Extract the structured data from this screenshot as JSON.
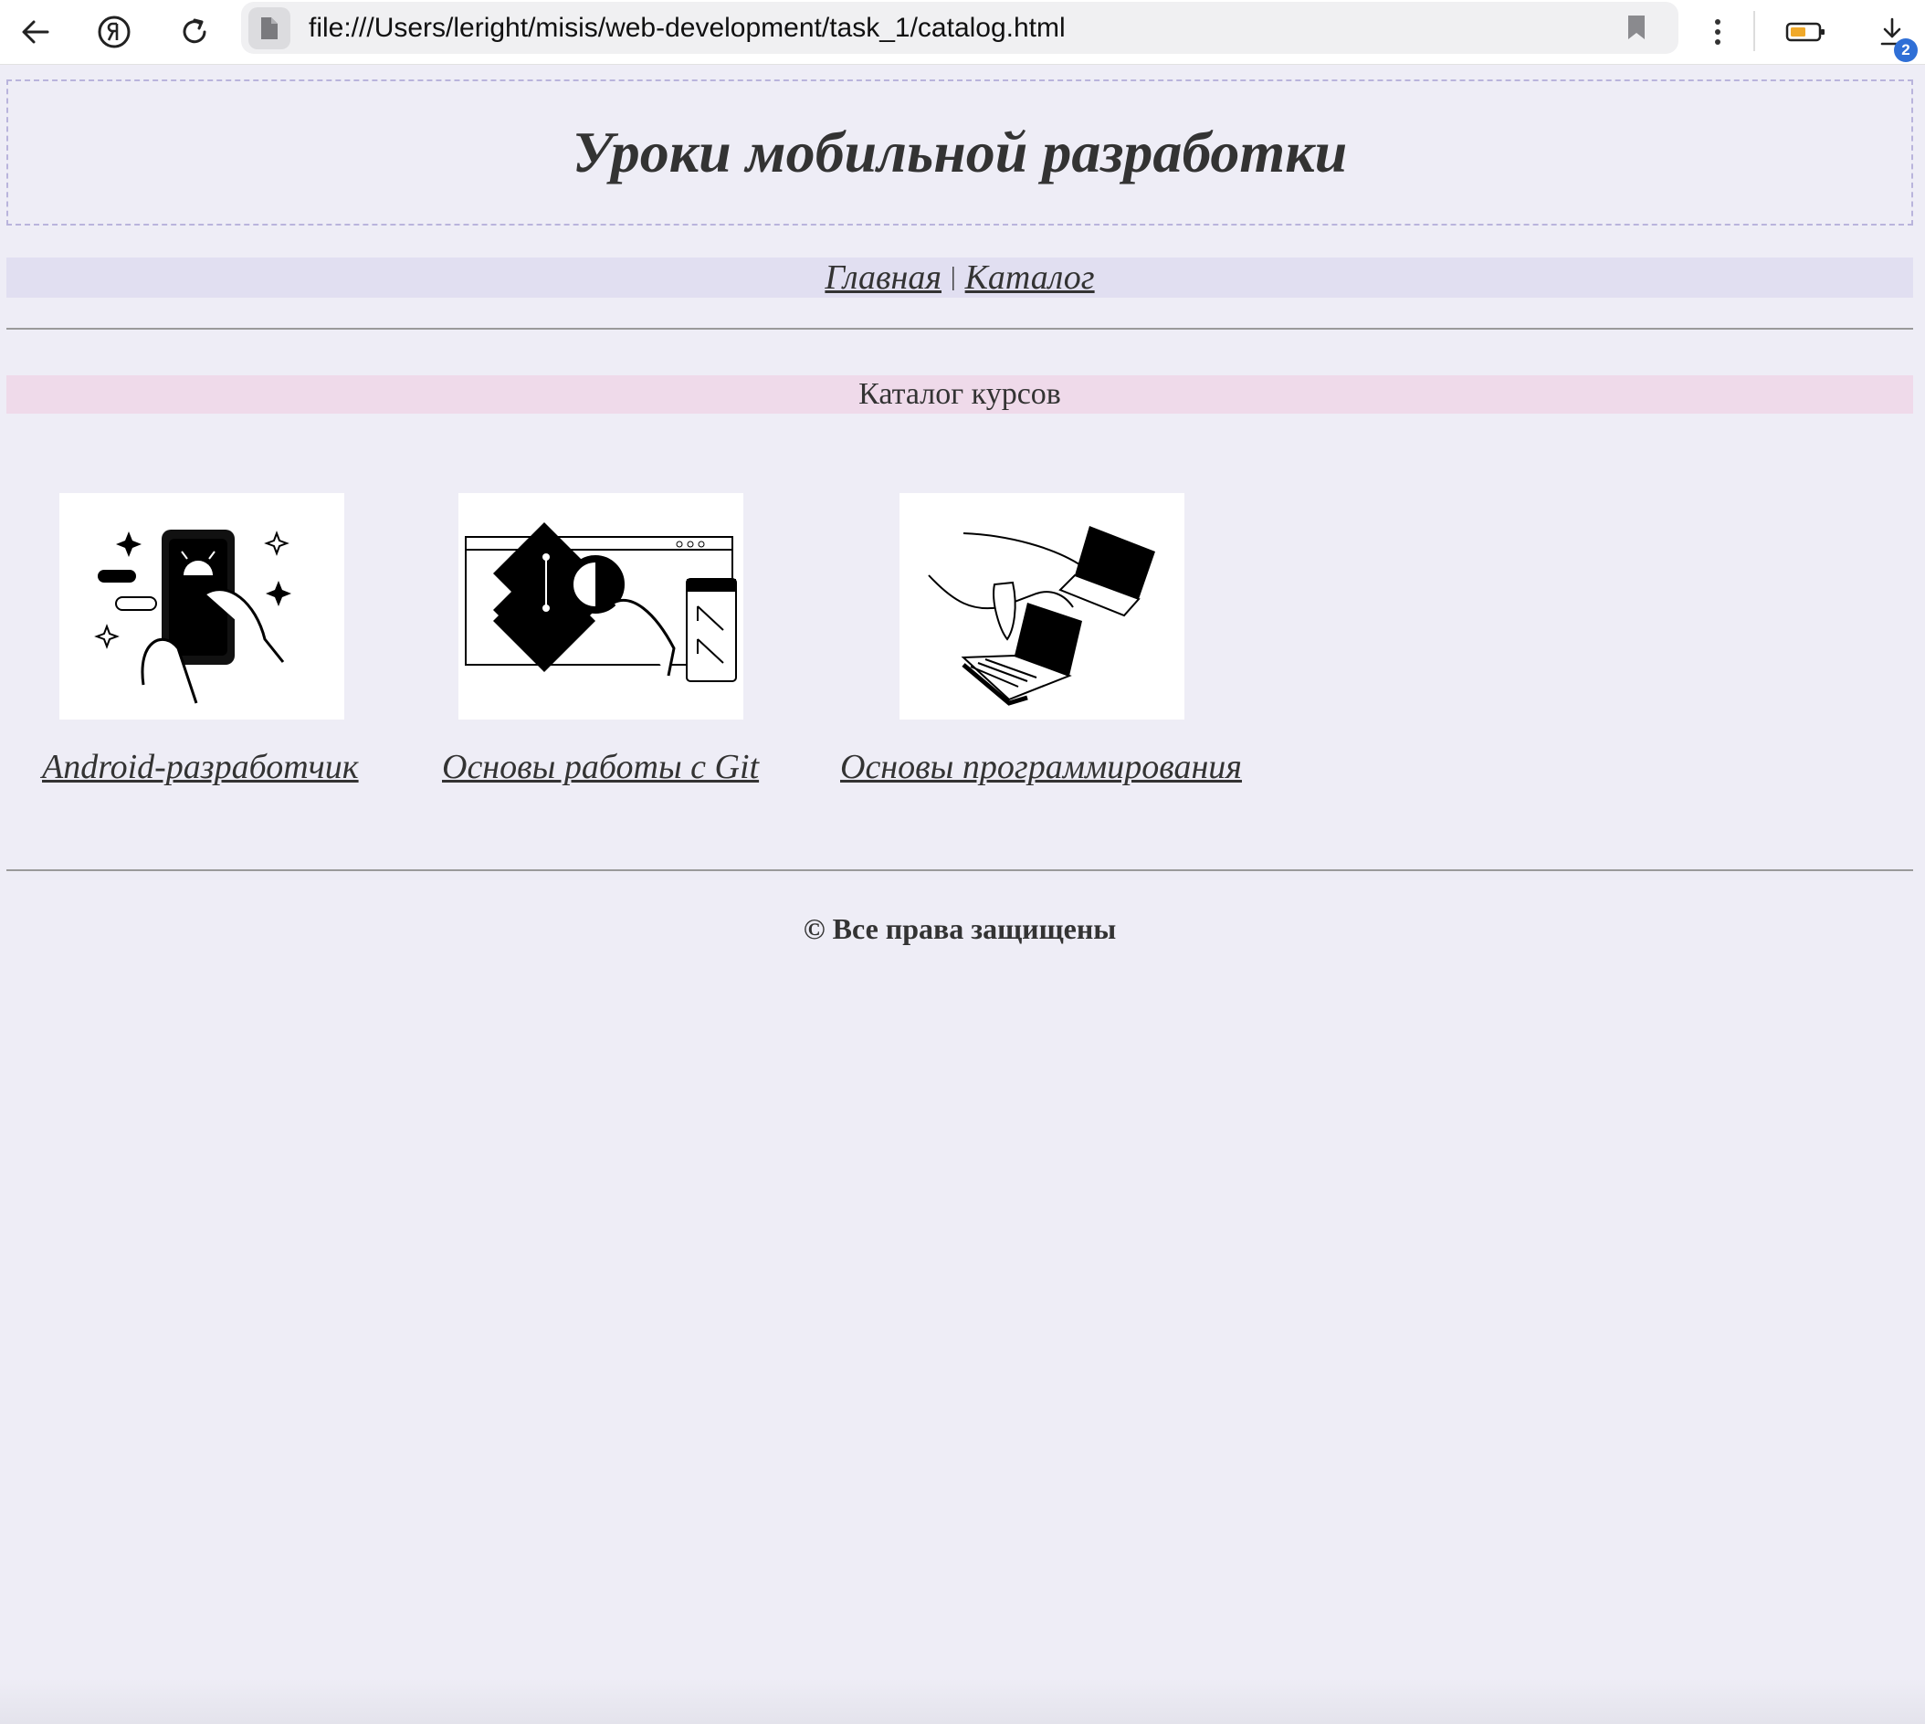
{
  "browser": {
    "url": "file:///Users/leright/misis/web-development/task_1/catalog.html",
    "downloads_count": "2",
    "icons": [
      "back-arrow-icon",
      "yandex-icon",
      "reload-icon",
      "page-icon",
      "bookmark-icon",
      "more-icon",
      "battery-icon",
      "downloads-icon"
    ]
  },
  "page": {
    "title": "Уроки мобильной разработки",
    "nav": {
      "home": "Главная",
      "separator": "|",
      "catalog": "Каталог"
    },
    "section_title": "Каталог курсов",
    "courses": [
      {
        "label": "Android-разработчик"
      },
      {
        "label": "Основы работы с Git"
      },
      {
        "label": "Основы программирования"
      }
    ],
    "footer": "© Все права защищены"
  },
  "colors": {
    "page_bg": "#eeedf6",
    "nav_bg": "#e1dff1",
    "section_bg": "#efdaea",
    "header_border": "#b9b4dc",
    "text": "#333333",
    "badge": "#2f6fd6"
  }
}
